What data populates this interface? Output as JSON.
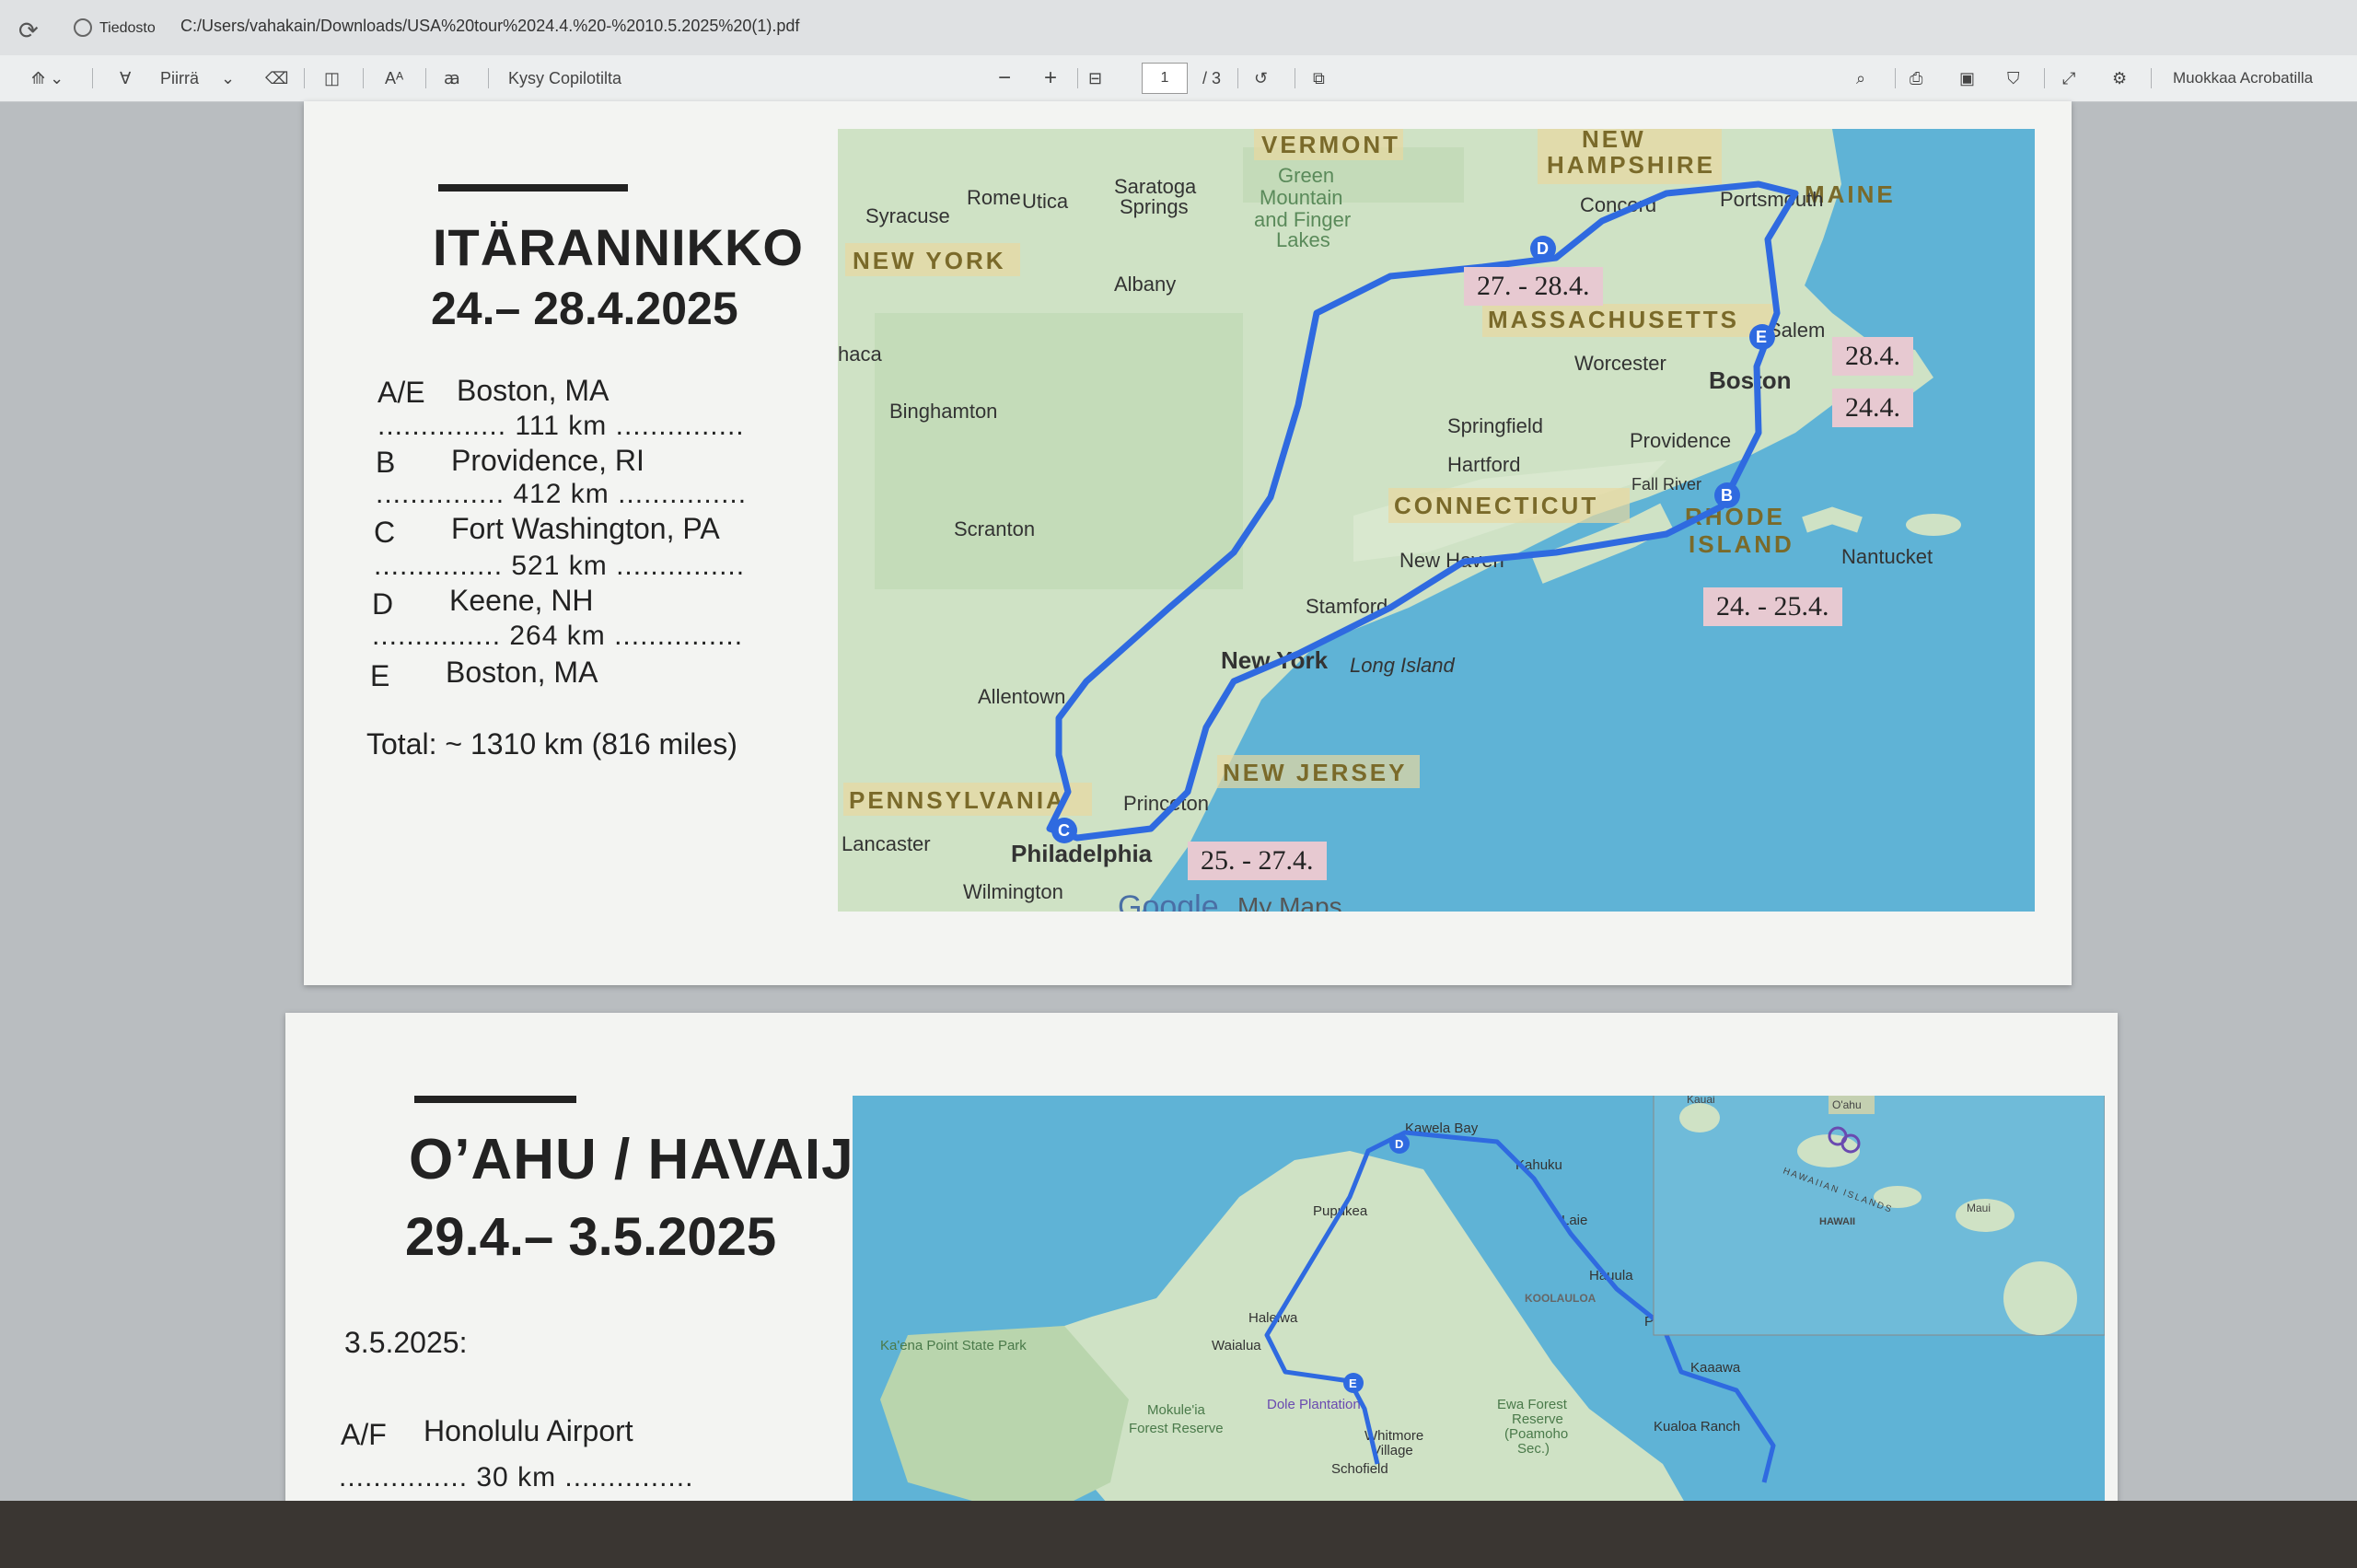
{
  "browser": {
    "site_label": "Tiedosto",
    "url": "C:/Users/vahakain/Downloads/USA%20tour%2024.4.%20-%2010.5.2025%20(1).pdf"
  },
  "toolbar": {
    "draw_label": "Piirrä",
    "ask_copilot": "Kysy Copilotilta",
    "page_current": "1",
    "page_total": "/ 3",
    "zoom_out": "−",
    "zoom_in": "+",
    "edit_acrobat": "Muokkaa Acrobatilla"
  },
  "east_coast": {
    "title": "ITÄRANNIKKO",
    "dates": "24.– 28.4.2025",
    "stops": [
      {
        "letter": "A/E",
        "name": "Boston, MA",
        "dist": "............... 111 km ..............."
      },
      {
        "letter": "B",
        "name": "Providence, RI",
        "dist": "............... 412 km ..............."
      },
      {
        "letter": "C",
        "name": "Fort Washington, PA",
        "dist": "............... 521 km ..............."
      },
      {
        "letter": "D",
        "name": "Keene, NH",
        "dist": "............... 264 km ..............."
      },
      {
        "letter": "E",
        "name": "Boston, MA",
        "dist": ""
      }
    ],
    "total": "Total: ~ 1310 km (816 miles)",
    "map_labels": {
      "vermont": "VERMONT",
      "new_hampshire_1": "NEW",
      "new_hampshire_2": "HAMPSHIRE",
      "maine": "MAINE",
      "new_york": "NEW YORK",
      "massachusetts": "MASSACHUSETTS",
      "connecticut": "CONNECTICUT",
      "rhode_island_1": "RHODE",
      "rhode_island_2": "ISLAND",
      "pennsylvania": "PENNSYLVANIA",
      "new_jersey": "NEW JERSEY",
      "syracuse": "Syracuse",
      "rome": "Rome",
      "utica": "Utica",
      "saratoga": "Saratoga",
      "springs": "Springs",
      "green": "Green",
      "mountain": "Mountain",
      "and_finger": "and Finger",
      "lakes": "Lakes",
      "concord": "Concord",
      "portsmouth": "Portsmouth",
      "albany": "Albany",
      "ithaca": "haca",
      "salem": "Salem",
      "worcester": "Worcester",
      "boston": "Boston",
      "binghamton": "Binghamton",
      "springfield": "Springfield",
      "hartford": "Hartford",
      "providence": "Providence",
      "fall_river": "Fall River",
      "scranton": "Scranton",
      "new_haven": "New Haven",
      "nantucket": "Nantucket",
      "stamford": "Stamford",
      "new_york_city": "New York",
      "long_island": "Long Island",
      "allentown": "Allentown",
      "princeton": "Princeton",
      "lancaster": "Lancaster",
      "philadelphia": "Philadelphia",
      "wilmington": "Wilmington",
      "google": "Google",
      "my_maps": "My Maps"
    },
    "date_tags": [
      "27. - 28.4.",
      "28.4.",
      "24.4.",
      "24. - 25.4.",
      "25. - 27.4."
    ]
  },
  "oahu": {
    "title": "O’AHU / HAVAIJI",
    "dates": "29.4.– 3.5.2025",
    "day_label": "3.5.2025:",
    "stops": [
      {
        "letter": "A/F",
        "name": "Honolulu Airport",
        "dist": "............... 30 km ..............."
      }
    ],
    "map_labels": {
      "kawela_bay": "Kawela Bay",
      "kahuku": "Kahuku",
      "laie": "Laie",
      "pupukea": "Pupukea",
      "hauula": "Hauula",
      "koolauloa": "KOOLAULOA",
      "haleiwa": "Haleiwa",
      "punaluu": "Punaluu",
      "kaena": "Ka'ena Point State Park",
      "waialua": "Waialua",
      "kaaawa": "Kaaawa",
      "mokuleia": "Mokule'ia",
      "forest_reserve": "Forest Reserve",
      "dole": "Dole Plantation",
      "ewa_forest": "Ewa Forest",
      "reserve": "Reserve",
      "poamoho": "(Poamoho",
      "sec": "Sec.)",
      "kualoa": "Kualoa Ranch",
      "whitmore": "Whitmore",
      "village": "Village",
      "schofield": "Schofield"
    },
    "inset_labels": {
      "oahu": "O'ahu",
      "kauai": "Kauai",
      "hawaiian_islands": "HAWAIIAN ISLANDS",
      "hawaii": "HAWAII",
      "maui": "Maui"
    }
  }
}
